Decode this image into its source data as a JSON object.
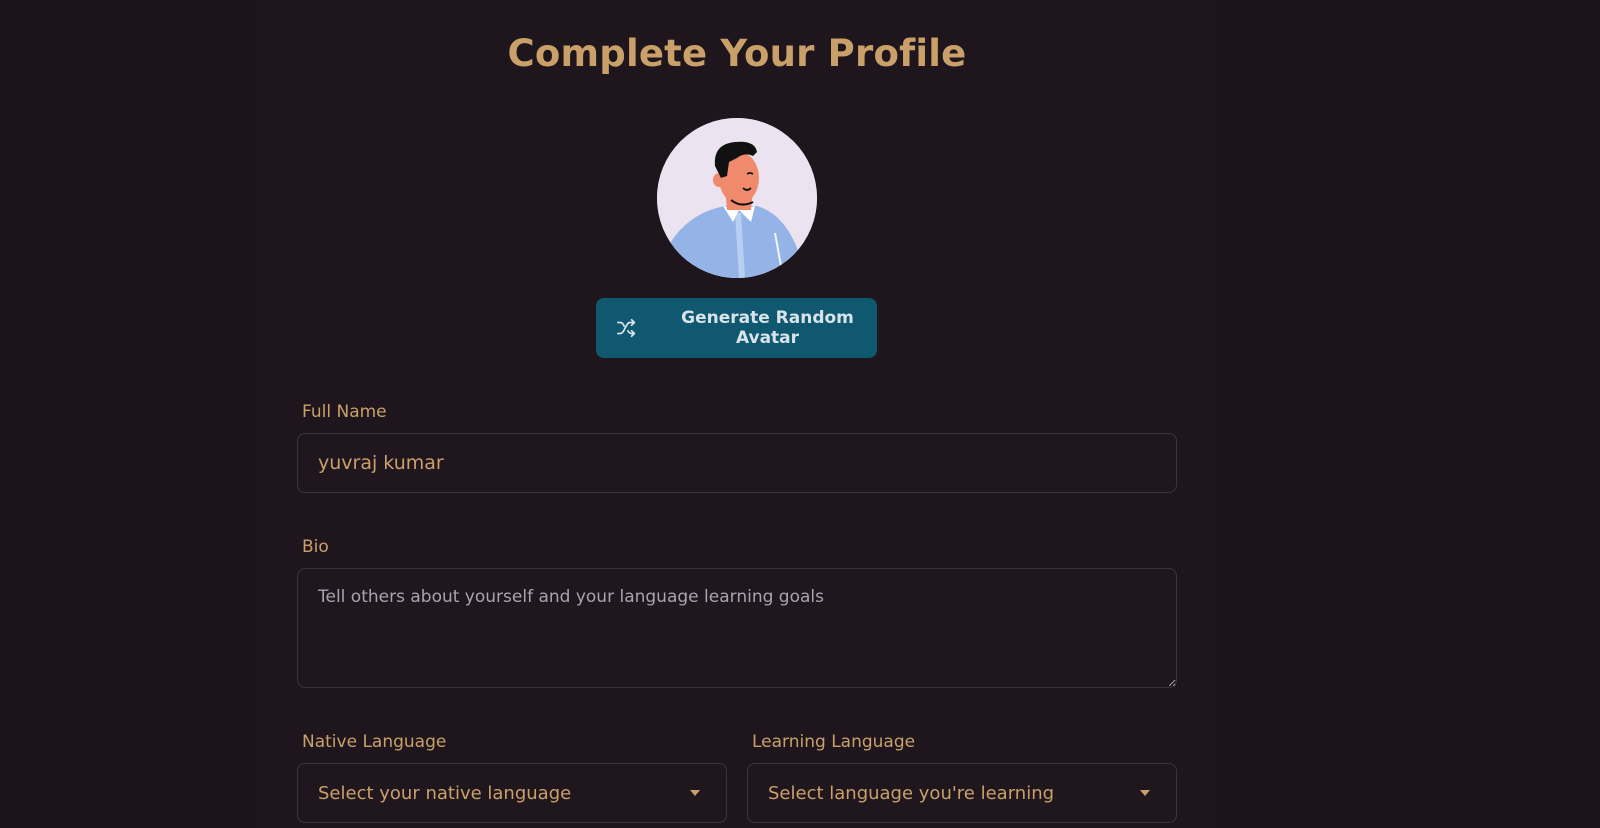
{
  "page": {
    "title": "Complete Your Profile"
  },
  "avatar": {
    "icon": "avatar-illustration"
  },
  "generate_button": {
    "label": "Generate Random Avatar",
    "icon": "shuffle-icon"
  },
  "form": {
    "full_name": {
      "label": "Full Name",
      "value": "yuvraj kumar"
    },
    "bio": {
      "label": "Bio",
      "value": "",
      "placeholder": "Tell others about yourself and your language learning goals"
    },
    "native_language": {
      "label": "Native Language",
      "selected": "Select your native language"
    },
    "learning_language": {
      "label": "Learning Language",
      "selected": "Select language you're learning"
    }
  },
  "colors": {
    "background": "#1c1419",
    "accent": "#c9a069",
    "button": "#0f5870"
  }
}
